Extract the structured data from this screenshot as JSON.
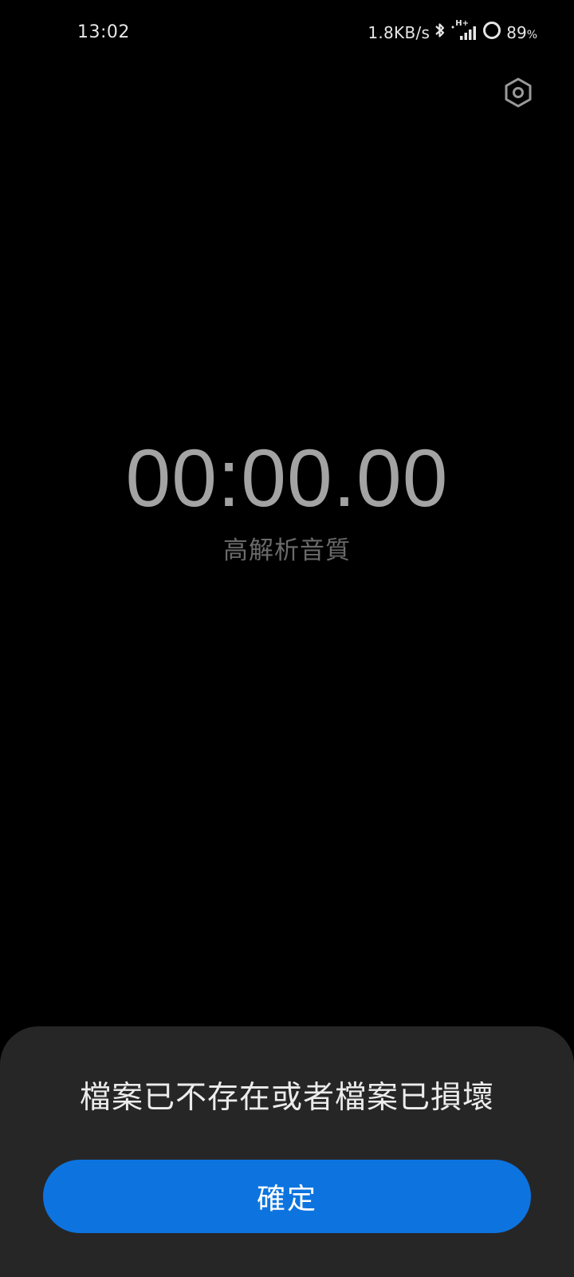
{
  "status_bar": {
    "time": "13:02",
    "net_speed": "1.8KB/s",
    "network_type": "H+",
    "battery_percent": "89",
    "battery_unit": "%",
    "icons": [
      "bluetooth-icon",
      "signal-icon",
      "battery-ring-icon"
    ]
  },
  "header": {
    "settings_icon": "gear-icon"
  },
  "recorder": {
    "timer": "00:00.00",
    "quality_label": "高解析音質"
  },
  "dialog": {
    "message": "檔案已不存在或者檔案已損壞",
    "confirm_label": "確定"
  },
  "colors": {
    "background": "#000000",
    "timer_text": "#a3a3a3",
    "dialog_bg": "#262626",
    "accent": "#0d74df"
  }
}
